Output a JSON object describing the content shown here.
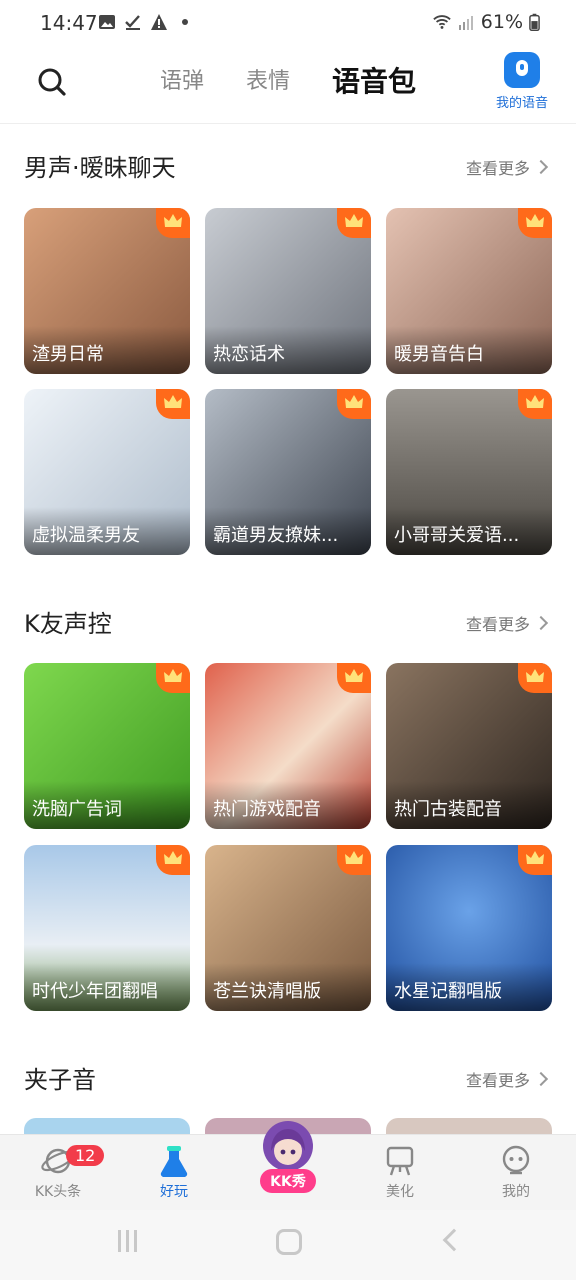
{
  "status_bar": {
    "time": "14:47",
    "battery": "61%",
    "icons": [
      "image-icon",
      "check-icon",
      "warning-icon",
      "dot-icon",
      "wifi-icon",
      "signal-icon",
      "battery-icon"
    ]
  },
  "header": {
    "tabs": [
      "语弹",
      "表情",
      "语音包"
    ],
    "active_tab": "语音包",
    "my_voice_label": "我的语音",
    "accent_color": "#1f7fe8",
    "highlight_color": "#ffd21e"
  },
  "sections": [
    {
      "title": "男声·暧昧聊天",
      "more_label": "查看更多",
      "items": [
        {
          "title": "渣男日常",
          "color": "#b07a5c"
        },
        {
          "title": "热恋话术",
          "color": "#9aa0a8"
        },
        {
          "title": "暖男音告白",
          "color": "#c59a86"
        },
        {
          "title": "虚拟温柔男友",
          "color": "#dfe6ee"
        },
        {
          "title": "霸道男友撩妹...",
          "color": "#7d8796"
        },
        {
          "title": "小哥哥关爱语...",
          "color": "#6b6760"
        }
      ]
    },
    {
      "title": "K友声控",
      "more_label": "查看更多",
      "items": [
        {
          "title": "洗脑广告词",
          "color": "#5bc232"
        },
        {
          "title": "热门游戏配音",
          "color": "#c94a3a"
        },
        {
          "title": "热门古装配音",
          "color": "#5a4a3e"
        },
        {
          "title": "时代少年团翻唱",
          "color": "#8fb3d6"
        },
        {
          "title": "苍兰诀清唱版",
          "color": "#c49a78"
        },
        {
          "title": "水星记翻唱版",
          "color": "#3f73c4"
        }
      ]
    },
    {
      "title": "夹子音",
      "more_label": "查看更多",
      "items": []
    }
  ],
  "bottom_nav": {
    "items": [
      {
        "label": "KK头条",
        "badge": "12"
      },
      {
        "label": "好玩"
      },
      {
        "label": "KK秀"
      },
      {
        "label": "美化"
      },
      {
        "label": "我的"
      }
    ],
    "active": "好玩"
  }
}
